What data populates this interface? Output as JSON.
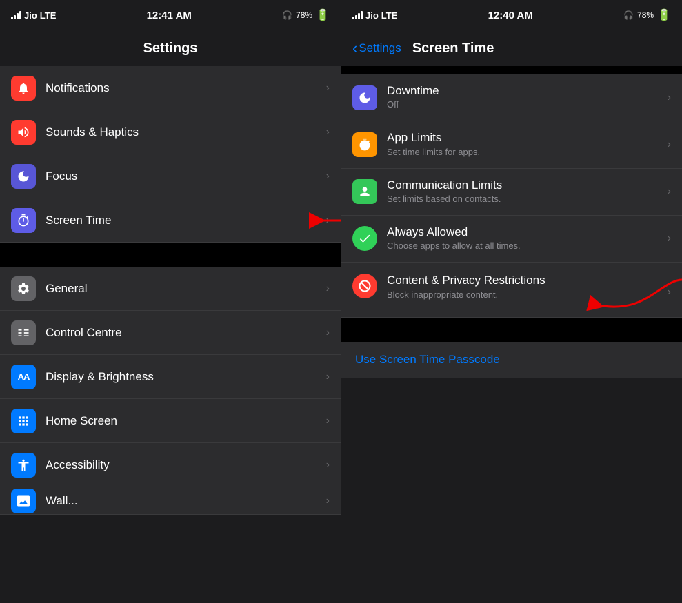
{
  "left": {
    "status_bar": {
      "carrier": "Jio",
      "network": "LTE",
      "time": "12:41 AM",
      "battery": "78%"
    },
    "title": "Settings",
    "group1": [
      {
        "id": "notifications",
        "label": "Notifications",
        "icon": "🔔",
        "icon_bg": "red"
      },
      {
        "id": "sounds",
        "label": "Sounds & Haptics",
        "icon": "🔊",
        "icon_bg": "red2"
      },
      {
        "id": "focus",
        "label": "Focus",
        "icon": "🌙",
        "icon_bg": "purple"
      },
      {
        "id": "screen-time",
        "label": "Screen Time",
        "icon": "⏳",
        "icon_bg": "purple2"
      }
    ],
    "group2": [
      {
        "id": "general",
        "label": "General",
        "icon": "⚙️",
        "icon_bg": "gray"
      },
      {
        "id": "control-centre",
        "label": "Control Centre",
        "icon": "⊟",
        "icon_bg": "gray2"
      },
      {
        "id": "display",
        "label": "Display & Brightness",
        "icon": "AA",
        "icon_bg": "blue"
      },
      {
        "id": "home-screen",
        "label": "Home Screen",
        "icon": "⋮⋮",
        "icon_bg": "blue2"
      },
      {
        "id": "accessibility",
        "label": "Accessibility",
        "icon": "♿",
        "icon_bg": "blue3"
      }
    ]
  },
  "right": {
    "status_bar": {
      "carrier": "Jio",
      "network": "LTE",
      "time": "12:40 AM",
      "battery": "78%"
    },
    "back_label": "Settings",
    "title": "Screen Time",
    "items": [
      {
        "id": "downtime",
        "label": "Downtime",
        "subtitle": "Off",
        "icon": "🌙",
        "icon_bg": "purple-dark"
      },
      {
        "id": "app-limits",
        "label": "App Limits",
        "subtitle": "Set time limits for apps.",
        "icon": "⏳",
        "icon_bg": "orange"
      },
      {
        "id": "comm-limits",
        "label": "Communication Limits",
        "subtitle": "Set limits based on contacts.",
        "icon": "👤",
        "icon_bg": "green"
      },
      {
        "id": "always-allowed",
        "label": "Always Allowed",
        "subtitle": "Choose apps to allow at all times.",
        "icon": "✓",
        "icon_bg": "green2"
      },
      {
        "id": "content-privacy",
        "label": "Content & Privacy Restrictions",
        "subtitle": "Block inappropriate content.",
        "icon": "🚫",
        "icon_bg": "red-round"
      }
    ],
    "passcode_label": "Use Screen Time Passcode"
  }
}
